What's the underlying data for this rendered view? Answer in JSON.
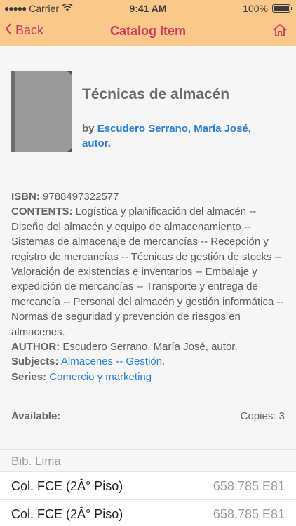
{
  "status_bar": {
    "carrier": "Carrier",
    "time": "9:41 AM",
    "battery": "100%"
  },
  "nav": {
    "back_label": "Back",
    "title": "Catalog Item"
  },
  "item": {
    "title": "Técnicas de almacén",
    "by_prefix": "by",
    "author_link": "Escudero Serrano, María José, autor.",
    "isbn_label": "ISBN:",
    "isbn": "9788497322577",
    "contents_label": "CONTENTS:",
    "contents": "Logística y planificación del almacén -- Diseño del almacén y equipo de almacenamiento -- Sistemas de almacenaje de mercancías -- Recepción y registro de mercancías -- Técnicas de gestión de stocks -- Valoración de existencias e inventarios -- Embalaje y expedición de mercancías -- Transporte y entrega de mercancía -- Personal del almacén y gestión informática -- Normas de seguridad y prevención de riesgos en almacenes.",
    "author_label": "AUTHOR:",
    "author": "Escudero Serrano, María José, autor.",
    "subjects_label": "Subjects:",
    "subjects": "Almacenes -- Gestión.",
    "series_label": "Series:",
    "series": "Comercio y marketing"
  },
  "availability": {
    "label": "Available:",
    "copies": "Copies: 3"
  },
  "holdings": {
    "location": "Bib. Lima",
    "rows": [
      {
        "collection": "Col. FCE (2Â° Piso)",
        "call_number": "658.785 E81"
      },
      {
        "collection": "Col. FCE (2Â° Piso)",
        "call_number": "658.785 E81"
      }
    ]
  },
  "colors": {
    "header_bg": "#f9c88a",
    "accent": "#cf3b5c",
    "link": "#2a7fd4"
  }
}
